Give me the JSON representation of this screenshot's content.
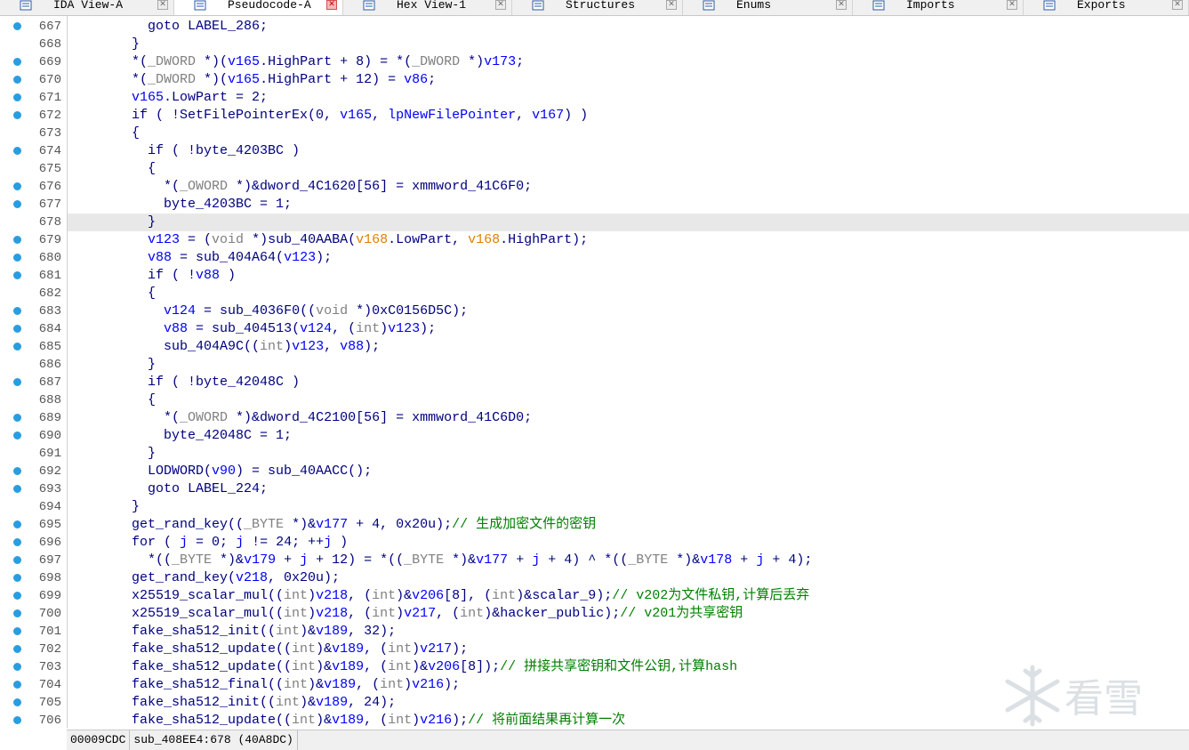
{
  "tabs": [
    {
      "label": "IDA View-A",
      "icon": "ida-view-icon",
      "active": false
    },
    {
      "label": "Pseudocode-A",
      "icon": "pseudocode-icon",
      "active": true
    },
    {
      "label": "Hex View-1",
      "icon": "hex-view-icon",
      "active": false
    },
    {
      "label": "Structures",
      "icon": "structures-icon",
      "active": false
    },
    {
      "label": "Enums",
      "icon": "enums-icon",
      "active": false
    },
    {
      "label": "Imports",
      "icon": "imports-icon",
      "active": false
    },
    {
      "label": "Exports",
      "icon": "exports-icon",
      "active": false
    }
  ],
  "colors": {
    "variable": "#0000ff",
    "type": "#808080",
    "comment": "#008000",
    "arg_highlight": "#e08000",
    "code": "#000080",
    "breakpoint_dot": "#2a9de0",
    "highlight_row": "#e8e8e8"
  },
  "code_lines": [
    {
      "n": "667",
      "text": "          goto LABEL_286;"
    },
    {
      "n": "668",
      "text": "        }"
    },
    {
      "n": "669",
      "text": "        *(_DWORD *)(v165.HighPart + 8) = *(_DWORD *)v173;"
    },
    {
      "n": "670",
      "text": "        *(_DWORD *)(v165.HighPart + 12) = v86;"
    },
    {
      "n": "671",
      "text": "        v165.LowPart = 2;"
    },
    {
      "n": "672",
      "text": "        if ( !SetFilePointerEx(0, v165, lpNewFilePointer, v167) )"
    },
    {
      "n": "673",
      "text": "        {"
    },
    {
      "n": "674",
      "text": "          if ( !byte_4203BC )"
    },
    {
      "n": "675",
      "text": "          {"
    },
    {
      "n": "676",
      "text": "            *(_OWORD *)&dword_4C1620[56] = xmmword_41C6F0;"
    },
    {
      "n": "677",
      "text": "            byte_4203BC = 1;"
    },
    {
      "n": "678",
      "text": "          }",
      "highlight": true
    },
    {
      "n": "679",
      "text": "          v123 = (void *)sub_40AABA(v168.LowPart, v168.HighPart);"
    },
    {
      "n": "680",
      "text": "          v88 = sub_404A64(v123);"
    },
    {
      "n": "681",
      "text": "          if ( !v88 )"
    },
    {
      "n": "682",
      "text": "          {"
    },
    {
      "n": "683",
      "text": "            v124 = sub_4036F0((void *)0xC0156D5C);"
    },
    {
      "n": "684",
      "text": "            v88 = sub_404513(v124, (int)v123);"
    },
    {
      "n": "685",
      "text": "            sub_404A9C((int)v123, v88);"
    },
    {
      "n": "686",
      "text": "          }"
    },
    {
      "n": "687",
      "text": "          if ( !byte_42048C )"
    },
    {
      "n": "688",
      "text": "          {"
    },
    {
      "n": "689",
      "text": "            *(_OWORD *)&dword_4C2100[56] = xmmword_41C6D0;"
    },
    {
      "n": "690",
      "text": "            byte_42048C = 1;"
    },
    {
      "n": "691",
      "text": "          }"
    },
    {
      "n": "692",
      "text": "          LODWORD(v90) = sub_40AACC();"
    },
    {
      "n": "693",
      "text": "          goto LABEL_224;"
    },
    {
      "n": "694",
      "text": "        }"
    },
    {
      "n": "695",
      "text": "        get_rand_key((_BYTE *)&v177 + 4, 0x20u);// 生成加密文件的密钥"
    },
    {
      "n": "696",
      "text": "        for ( j = 0; j != 24; ++j )"
    },
    {
      "n": "697",
      "text": "          *((_BYTE *)&v179 + j + 12) = *((_BYTE *)&v177 + j + 4) ^ *((_BYTE *)&v178 + j + 4);"
    },
    {
      "n": "698",
      "text": "        get_rand_key(v218, 0x20u);"
    },
    {
      "n": "699",
      "text": "        x25519_scalar_mul((int)v218, (int)&v206[8], (int)&scalar_9);// v202为文件私钥,计算后丢弃"
    },
    {
      "n": "700",
      "text": "        x25519_scalar_mul((int)v218, (int)v217, (int)&hacker_public);// v201为共享密钥"
    },
    {
      "n": "701",
      "text": "        fake_sha512_init((int)&v189, 32);"
    },
    {
      "n": "702",
      "text": "        fake_sha512_update((int)&v189, (int)v217);"
    },
    {
      "n": "703",
      "text": "        fake_sha512_update((int)&v189, (int)&v206[8]);// 拼接共享密钥和文件公钥,计算hash"
    },
    {
      "n": "704",
      "text": "        fake_sha512_final((int)&v189, (int)v216);"
    },
    {
      "n": "705",
      "text": "        fake_sha512_init((int)&v189, 24);"
    },
    {
      "n": "706",
      "text": "        fake_sha512_update((int)&v189, (int)v216);// 将前面结果再计算一次"
    }
  ],
  "statusbar": {
    "offset": "00009CDC",
    "location": "sub_408EE4:678 (40A8DC)"
  },
  "watermark": {
    "text": "看雪",
    "icon": "snowflake-icon"
  }
}
